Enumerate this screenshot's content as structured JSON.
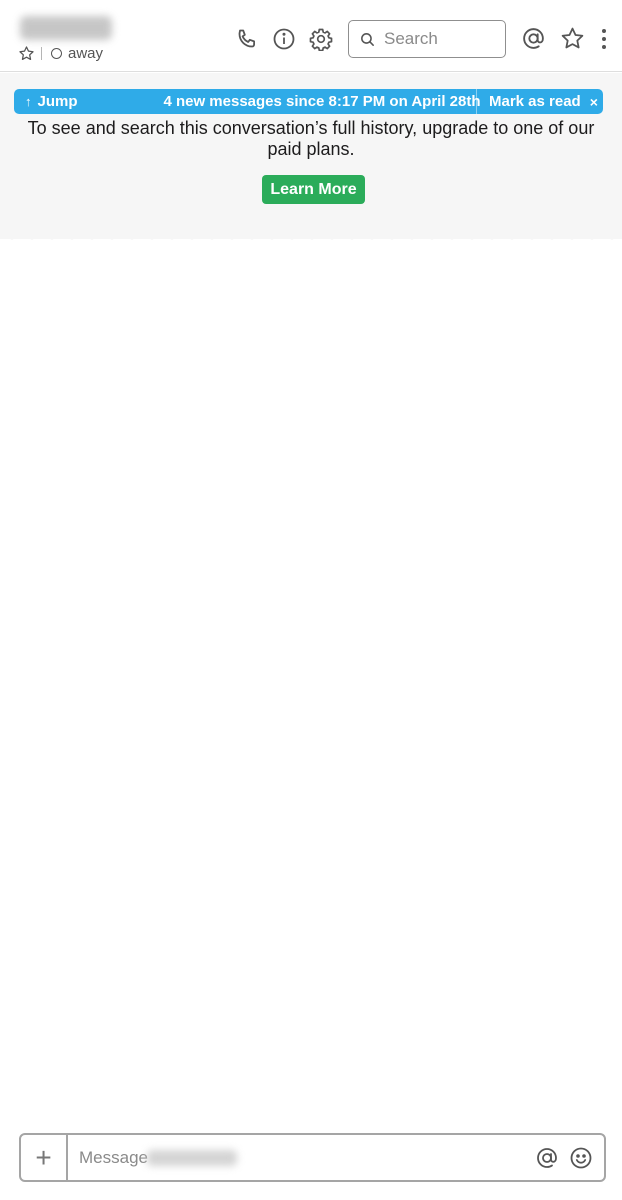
{
  "header": {
    "presence": "away",
    "icons": [
      "star-icon",
      "call-icon",
      "info-icon",
      "gear-icon",
      "search-icon",
      "mentions-icon",
      "star-icon",
      "more-vertical-icon"
    ],
    "search": {
      "placeholder": "Search"
    }
  },
  "banner": {
    "jump_label": "Jump",
    "new_messages_text": "4 new messages since 8:17 PM on April 28th",
    "mark_read_label": "Mark as read",
    "close_glyph": "×"
  },
  "history_notice": {
    "text": "To see and search this conversation’s full history, upgrade to one of our paid plans.",
    "button_label": "Learn More"
  },
  "composer": {
    "placeholder": "Message",
    "plus_glyph": "+"
  },
  "colors": {
    "banner_blue": "#2fabe8",
    "learn_more_green": "#2bac5a",
    "history_bg": "#f6f6f6"
  }
}
